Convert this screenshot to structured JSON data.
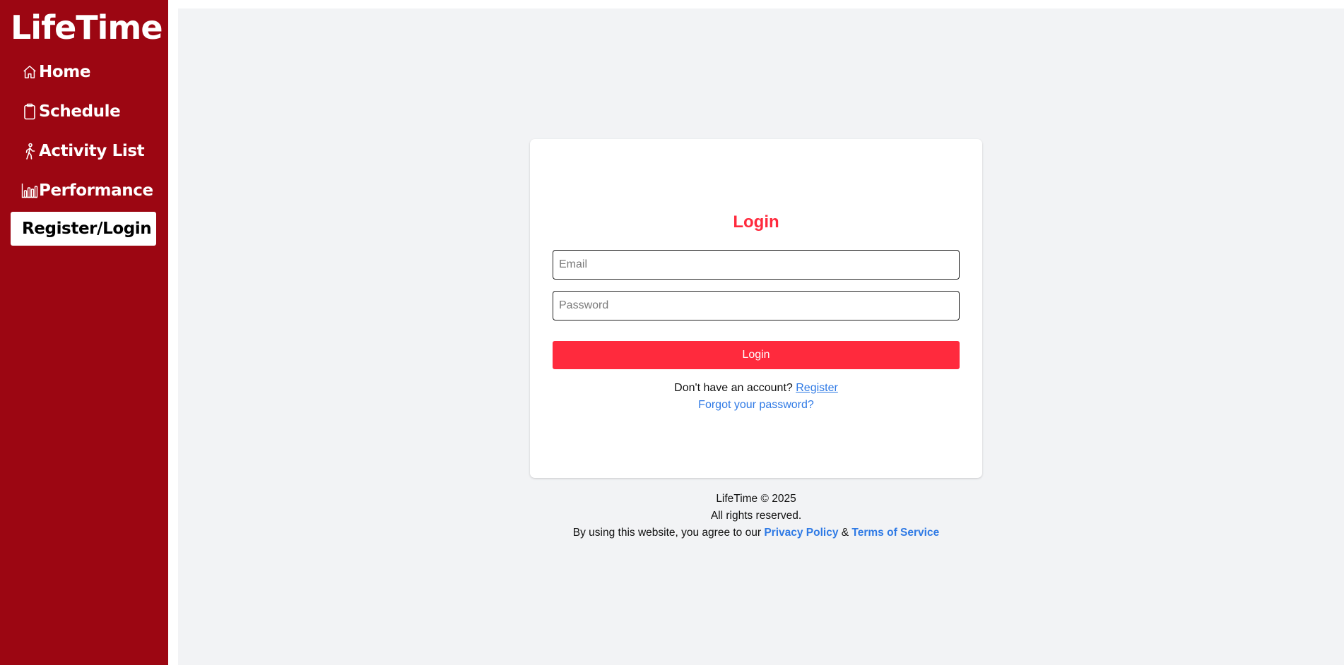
{
  "sidebar": {
    "brand": "LifeTime",
    "items": [
      {
        "label": "Home",
        "icon": "home-icon"
      },
      {
        "label": "Schedule",
        "icon": "clipboard-icon"
      },
      {
        "label": "Activity List",
        "icon": "walking-person-icon"
      },
      {
        "label": "Performance",
        "icon": "bar-chart-icon"
      }
    ],
    "active_item": {
      "label": "Register/Login"
    }
  },
  "login": {
    "title": "Login",
    "email_placeholder": "Email",
    "password_placeholder": "Password",
    "button_label": "Login",
    "no_account_text": "Don't have an account?",
    "register_link": "Register",
    "forgot_link": "Forgot your password?"
  },
  "footer": {
    "copyright": "LifeTime © 2025",
    "rights": "All rights reserved.",
    "agree_text": "By using this website, you agree to our",
    "privacy_link": "Privacy Policy",
    "ampersand": "&",
    "terms_link": "Terms of Service"
  },
  "colors": {
    "sidebar_bg": "#9c0612",
    "accent_red": "#ff2a3d",
    "link_blue": "#2f7ae5",
    "page_bg": "#f2f3f5"
  }
}
